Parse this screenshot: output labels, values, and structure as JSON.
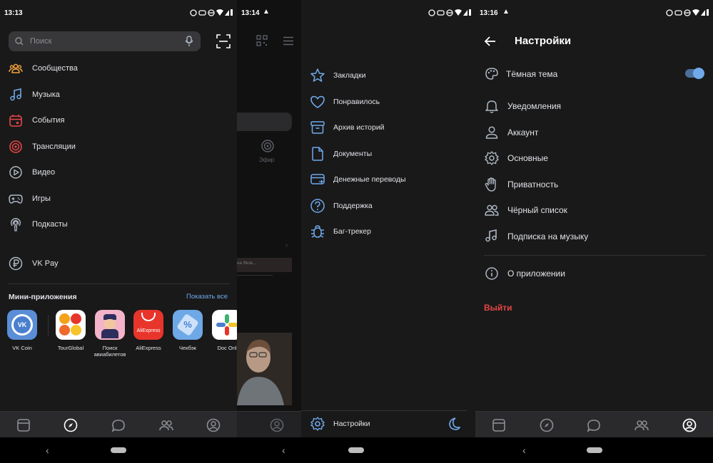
{
  "colors": {
    "accent": "#71aaeb",
    "danger": "#e64646",
    "background": "#19191a"
  },
  "panel1": {
    "time": "13:13",
    "search_placeholder": "Поиск",
    "menu": [
      {
        "label": "Сообщества",
        "icon": "communities-icon",
        "color": "#f2a33a"
      },
      {
        "label": "Музыка",
        "icon": "music-note-icon",
        "color": "#71aaeb"
      },
      {
        "label": "События",
        "icon": "calendar-icon",
        "color": "#e64646"
      },
      {
        "label": "Трансляции",
        "icon": "broadcast-icon",
        "color": "#e64646"
      },
      {
        "label": "Видео",
        "icon": "play-circle-icon",
        "color": "#aeb7c2"
      },
      {
        "label": "Игры",
        "icon": "gamepad-icon",
        "color": "#aeb7c2"
      },
      {
        "label": "Подкасты",
        "icon": "podcast-icon",
        "color": "#aeb7c2"
      }
    ],
    "vkpay": {
      "label": "VK Pay",
      "icon": "ruble-circle-icon"
    },
    "mini_apps_title": "Мини-приложения",
    "show_all": "Показать все",
    "apps": [
      {
        "name": "VK Coin",
        "icon": "vk-coin-icon"
      },
      {
        "name": "TourGlobal",
        "icon": "tourglobal-icon"
      },
      {
        "name": "Поиск авиабилетов",
        "icon": "pilot-icon"
      },
      {
        "name": "AliExpress",
        "icon": "aliexpress-icon"
      },
      {
        "name": "Чекбэк",
        "icon": "checkback-icon"
      },
      {
        "name": "Doc Onl",
        "icon": "doc-online-icon"
      }
    ]
  },
  "panel2": {
    "time": "13:14",
    "live_label": "Эфир",
    "video_caption": "на Яков..."
  },
  "panel3": {
    "menu": [
      {
        "label": "Закладки",
        "icon": "star-icon"
      },
      {
        "label": "Понравилось",
        "icon": "heart-icon"
      },
      {
        "label": "Архив историй",
        "icon": "archive-icon"
      },
      {
        "label": "Документы",
        "icon": "document-icon"
      },
      {
        "label": "Денежные переводы",
        "icon": "money-transfer-icon"
      },
      {
        "label": "Поддержка",
        "icon": "help-icon"
      },
      {
        "label": "Баг-трекер",
        "icon": "bug-icon"
      }
    ],
    "settings_label": "Настройки"
  },
  "panel4": {
    "time": "13:16",
    "title": "Настройки",
    "dark_theme_label": "Тёмная тема",
    "dark_theme_on": true,
    "items": [
      {
        "label": "Уведомления",
        "icon": "bell-icon"
      },
      {
        "label": "Аккаунт",
        "icon": "user-icon"
      },
      {
        "label": "Основные",
        "icon": "gear-icon"
      },
      {
        "label": "Приватность",
        "icon": "hand-icon"
      },
      {
        "label": "Чёрный список",
        "icon": "users-icon"
      },
      {
        "label": "Подписка на музыку",
        "icon": "music-note-icon"
      }
    ],
    "about_label": "О приложении",
    "logout_label": "Выйти"
  }
}
